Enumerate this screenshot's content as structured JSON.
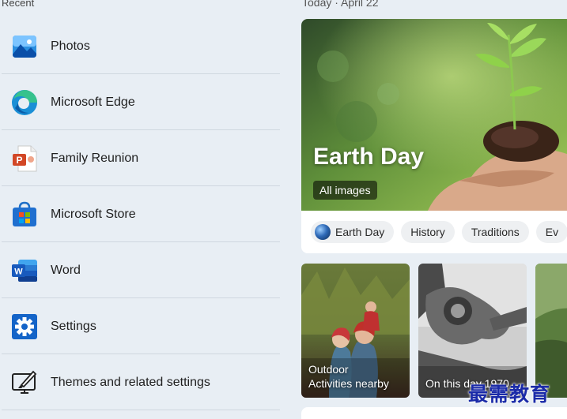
{
  "recent": {
    "label": "Recent",
    "items": [
      {
        "label": "Photos",
        "icon": "photos-icon"
      },
      {
        "label": "Microsoft Edge",
        "icon": "edge-icon"
      },
      {
        "label": "Family Reunion",
        "icon": "powerpoint-file-icon"
      },
      {
        "label": "Microsoft Store",
        "icon": "store-icon"
      },
      {
        "label": "Word",
        "icon": "word-icon"
      },
      {
        "label": "Settings",
        "icon": "gear-icon"
      },
      {
        "label": "Themes and related settings",
        "icon": "themes-icon"
      }
    ]
  },
  "feed": {
    "date": "Today  ·  April 22",
    "hero": {
      "title": "Earth Day",
      "button": "All images"
    },
    "chips": [
      "Earth Day",
      "History",
      "Traditions",
      "Ev"
    ],
    "cards": [
      {
        "caption_line1": "Outdoor",
        "caption_line2": "Activities nearby"
      },
      {
        "caption_line1": "On this day 1970",
        "caption_line2": ""
      },
      {
        "caption_line1": "",
        "caption_line2": ""
      }
    ]
  },
  "watermark": "最需教育",
  "colors": {
    "background": "#e8eef4",
    "divider": "#cfd7df",
    "watermark": "#1a2aa8"
  }
}
